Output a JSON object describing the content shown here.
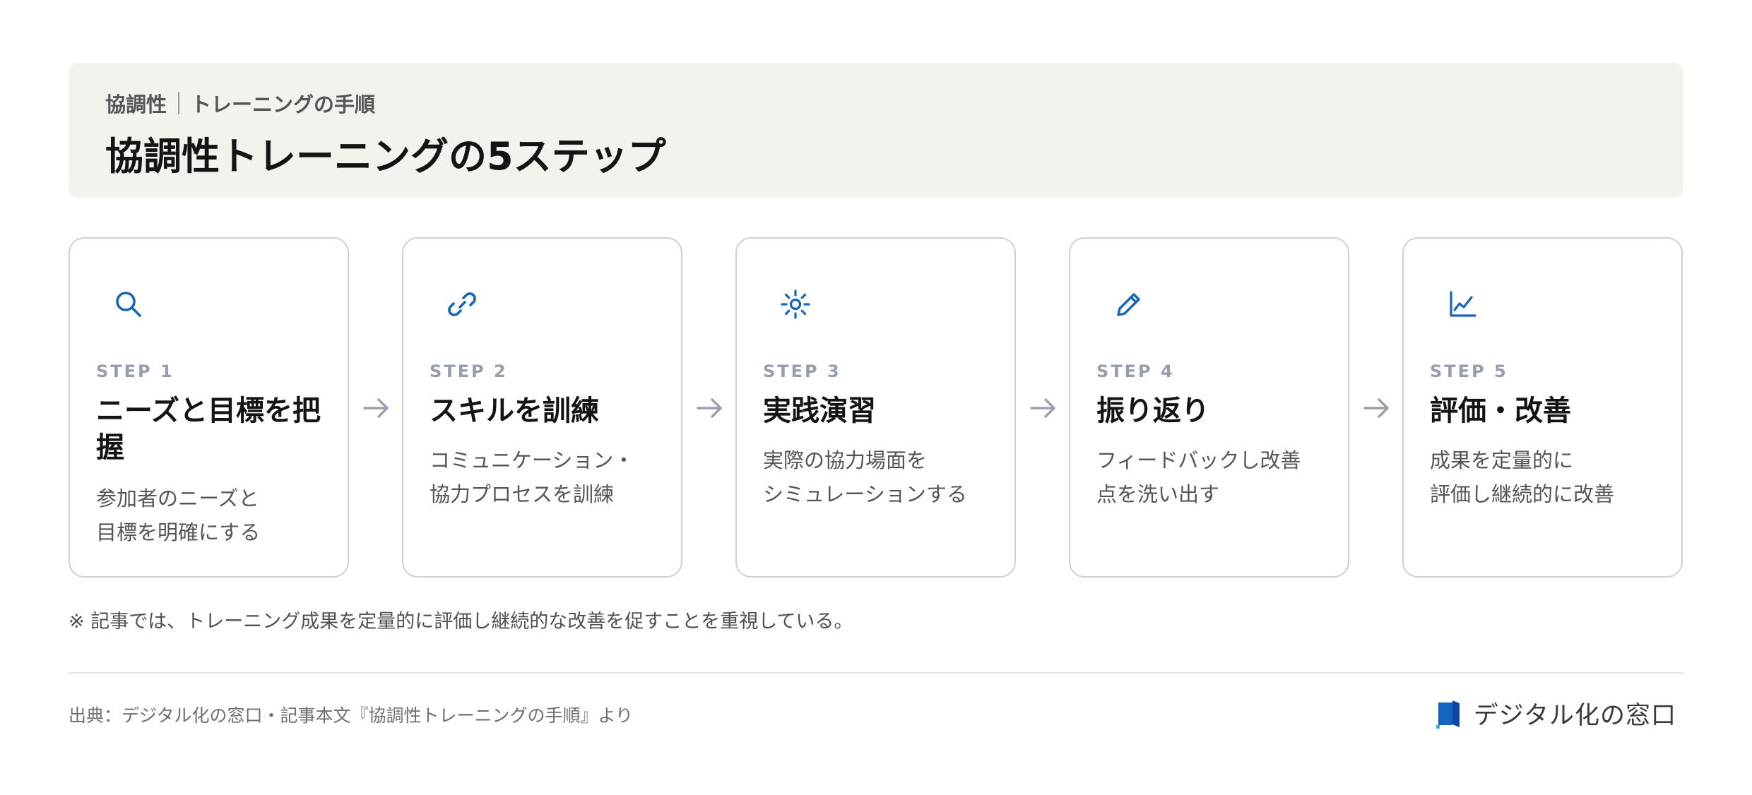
{
  "header": {
    "breadcrumb_category": "協調性",
    "breadcrumb_page": "トレーニングの手順",
    "title": "協調性トレーニングの5ステップ"
  },
  "steps": [
    {
      "label": "STEP 1",
      "icon": "search-icon",
      "title": "ニーズと目標を把握",
      "desc_lines": [
        "参加者のニーズと",
        "目標を明確にする"
      ]
    },
    {
      "label": "STEP 2",
      "icon": "link-icon",
      "title": "スキルを訓練",
      "desc_lines": [
        "コミュニケーション・",
        "協力プロセスを訓練"
      ]
    },
    {
      "label": "STEP 3",
      "icon": "sun-icon",
      "title": "実践演習",
      "desc_lines": [
        "実際の協力場面を",
        "シミュレーションする"
      ]
    },
    {
      "label": "STEP 4",
      "icon": "pencil-icon",
      "title": "振り返り",
      "desc_lines": [
        "フィードバックし改善",
        "点を洗い出す"
      ]
    },
    {
      "label": "STEP 5",
      "icon": "chart-icon",
      "title": "評価・改善",
      "desc_lines": [
        "成果を定量的に",
        "評価し継続的に改善"
      ]
    }
  ],
  "footnote": "※ 記事では、トレーニング成果を定量的に評価し継続的な改善を促すことを重視している。",
  "footer": {
    "source": "出典：デジタル化の窓口・記事本文『協調性トレーニングの手順』より",
    "brand_name": "デジタル化の窓口"
  },
  "colors": {
    "accent": "#1565c0",
    "step_label": "#969eab",
    "card_border": "#cdd0d6",
    "header_bg": "#f4f2ed"
  }
}
